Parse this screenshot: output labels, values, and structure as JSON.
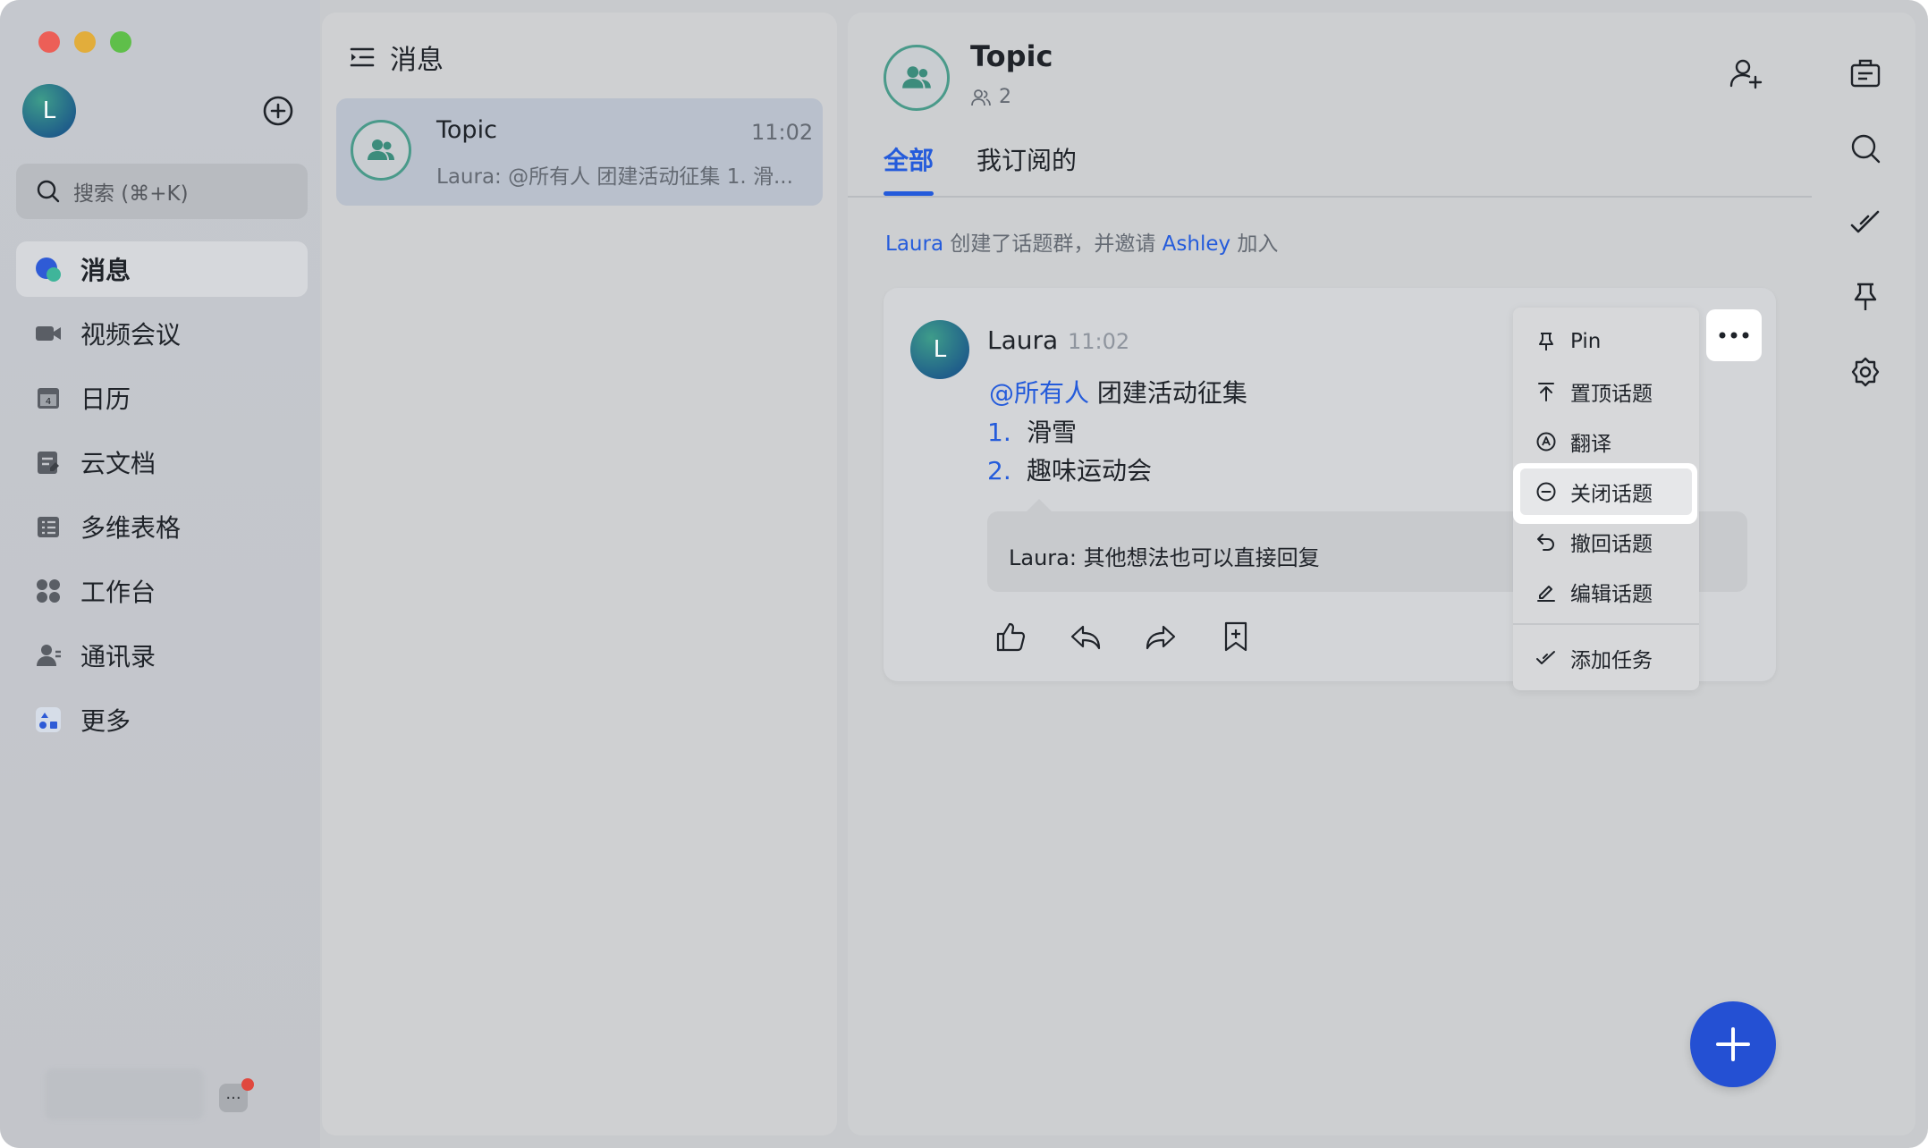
{
  "window": {
    "traffic_lights": [
      "#ec5f57",
      "#e2ad3b",
      "#5fbf4a"
    ]
  },
  "sidebar": {
    "avatar_initial": "L",
    "search_placeholder": "搜索 (⌘+K)",
    "items": [
      {
        "label": "消息",
        "icon": "message-icon",
        "active": true
      },
      {
        "label": "视频会议",
        "icon": "video-icon"
      },
      {
        "label": "日历",
        "icon": "calendar-icon"
      },
      {
        "label": "云文档",
        "icon": "docs-icon"
      },
      {
        "label": "多维表格",
        "icon": "table-icon"
      },
      {
        "label": "工作台",
        "icon": "workplace-icon"
      },
      {
        "label": "通讯录",
        "icon": "contacts-icon"
      },
      {
        "label": "更多",
        "icon": "more-apps-icon"
      }
    ],
    "bottom_more": "···"
  },
  "list": {
    "title": "消息",
    "conversations": [
      {
        "name": "Topic",
        "time": "11:02",
        "preview": "Laura: @所有人 团建活动征集 1. 滑..."
      }
    ]
  },
  "chat": {
    "name": "Topic",
    "member_count": "2",
    "tabs": [
      "全部",
      "我订阅的"
    ],
    "system": {
      "actor": "Laura",
      "text1": " 创建了话题群，并邀请 ",
      "invitee": "Ashley",
      "text2": " 加入"
    },
    "message": {
      "author": "Laura",
      "author_initial": "L",
      "time": "11:02",
      "mention": "@所有人",
      "title": " 团建活动征集",
      "list": [
        {
          "num": "1.",
          "text": "滑雪"
        },
        {
          "num": "2.",
          "text": "趣味运动会"
        }
      ],
      "reply": "Laura: 其他想法也可以直接回复"
    },
    "menu": [
      {
        "label": "Pin",
        "icon": "pin-icon"
      },
      {
        "label": "置顶话题",
        "icon": "pin-top-icon"
      },
      {
        "label": "翻译",
        "icon": "translate-icon"
      },
      {
        "label": "关闭话题",
        "icon": "close-topic-icon",
        "highlighted": true
      },
      {
        "label": "撤回话题",
        "icon": "recall-icon"
      },
      {
        "label": "编辑话题",
        "icon": "edit-icon"
      },
      {
        "label": "添加任务",
        "icon": "task-icon"
      }
    ]
  },
  "colors": {
    "accent": "#245bdb",
    "fab": "#2450d3"
  }
}
